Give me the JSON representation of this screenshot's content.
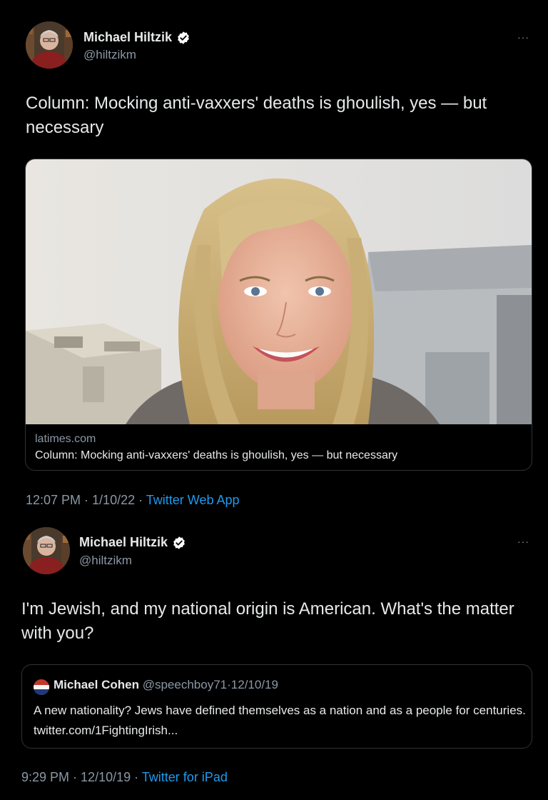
{
  "tweets": [
    {
      "author_name": "Michael Hiltzik",
      "author_handle": "@hiltzikm",
      "more": "···",
      "text": "Column: Mocking anti-vaxxers' deaths is ghoulish, yes — but necessary",
      "card": {
        "domain": "latimes.com",
        "title": "Column: Mocking anti-vaxxers' deaths is ghoulish, yes — but necessary"
      },
      "time": "12:07 PM",
      "sep1": " · ",
      "date": "1/10/22",
      "sep2": " · ",
      "app": "Twitter Web App"
    },
    {
      "author_name": "Michael Hiltzik",
      "author_handle": "@hiltzikm",
      "more": "···",
      "text": "I'm Jewish, and my national origin is American. What's the matter with you?",
      "quote": {
        "author_name": "Michael Cohen",
        "author_handle": "@speechboy71",
        "sep": "·",
        "date": "12/10/19",
        "text": "A new nationality? Jews have defined themselves as a nation and as a people for centuries. twitter.com/1FightingIrish..."
      },
      "time": "9:29 PM",
      "sep1": " · ",
      "date": "12/10/19",
      "sep2": " · ",
      "app": "Twitter for iPad"
    }
  ],
  "colors": {
    "background": "#000000",
    "text": "#e7e9ea",
    "secondary": "#8b98a5",
    "link": "#1d9bf0",
    "verified": "#ffffff"
  },
  "icons": [
    "verified-badge-icon",
    "more-options-icon"
  ]
}
